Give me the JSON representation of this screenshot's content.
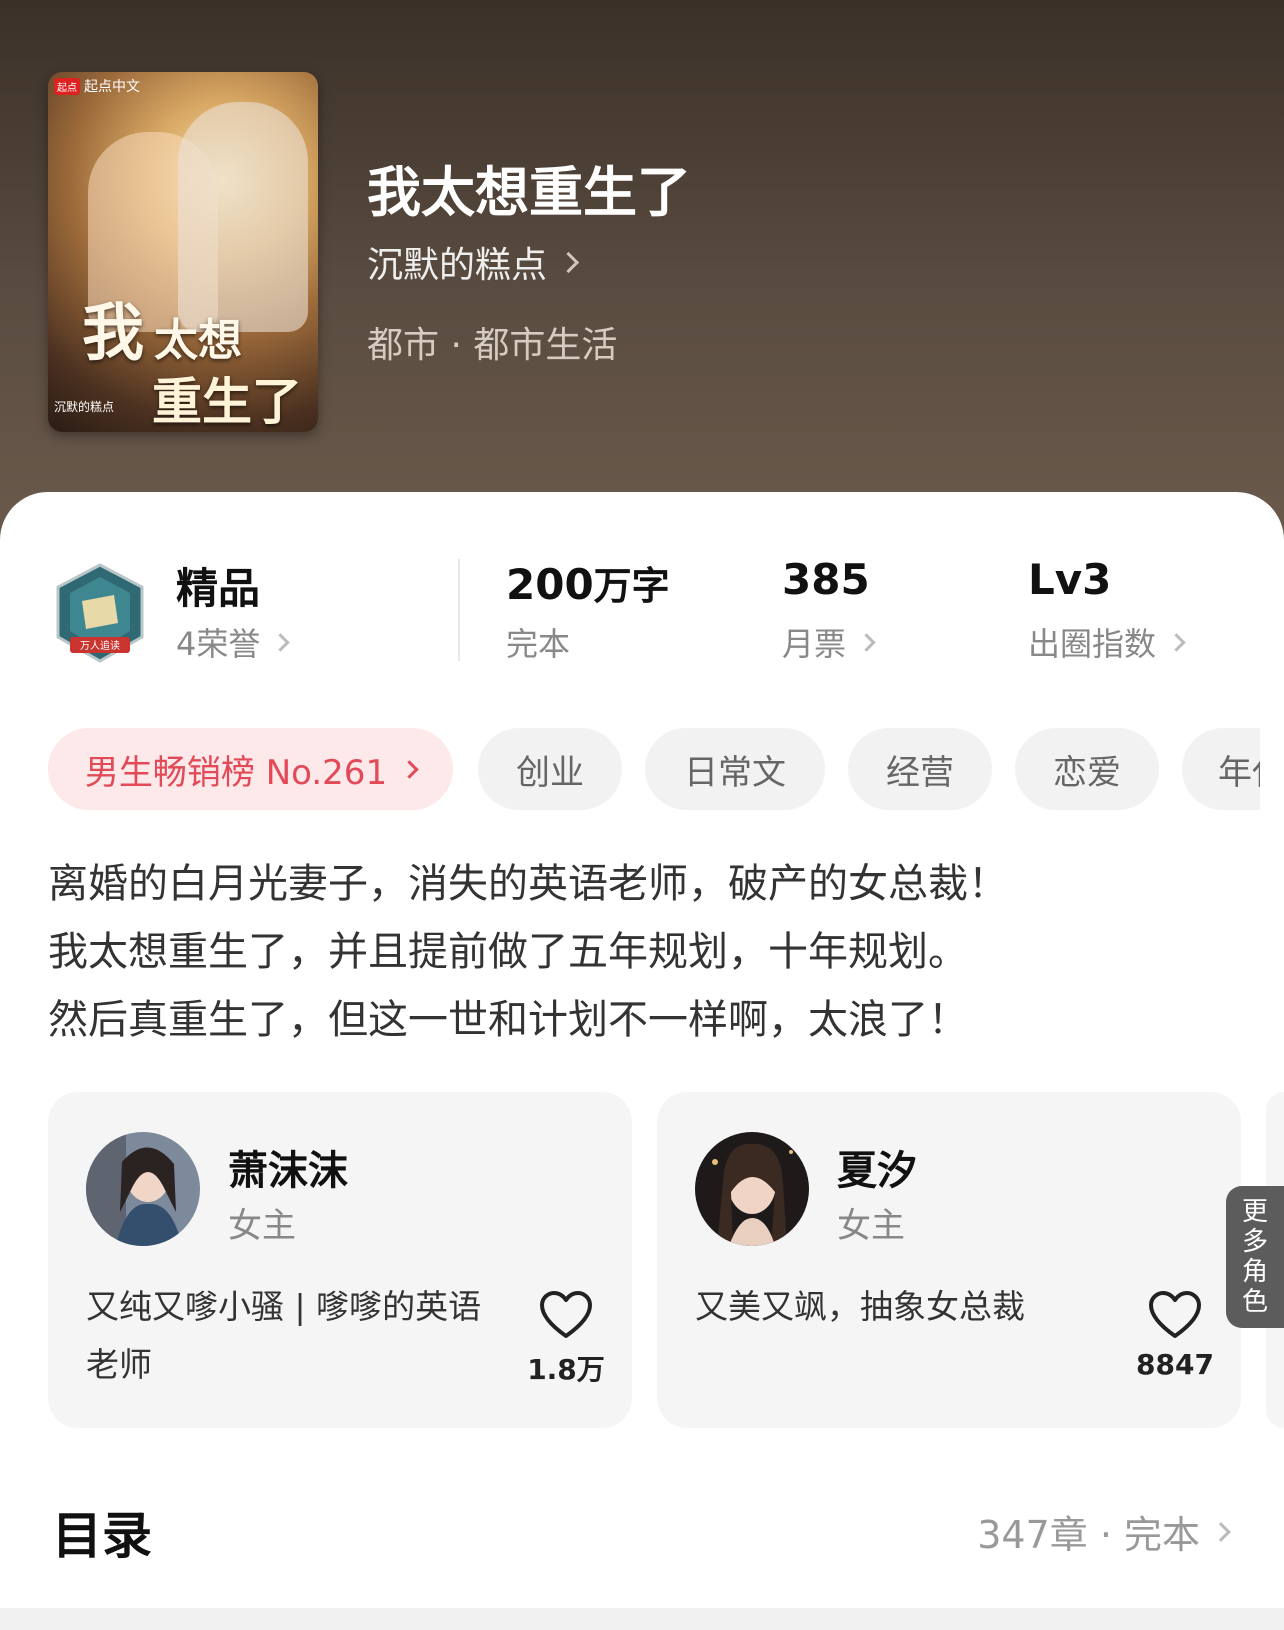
{
  "book": {
    "cover": {
      "publisher": "起点",
      "publisher_sub": "起点中文",
      "title_line1": "我",
      "title_line2": "太想",
      "title_line3": "重生了",
      "author_small": "沉默的糕点"
    },
    "title": "我太想重生了",
    "author": "沉默的糕点",
    "genre": "都市 · 都市生活"
  },
  "stats": {
    "quality": {
      "label": "精品",
      "sub": "4荣誉",
      "medal_text": "万人追读"
    },
    "words": {
      "value": "200",
      "unit": "万字",
      "sub": "完本"
    },
    "tickets": {
      "value": "385",
      "sub": "月票"
    },
    "index": {
      "value": "Lv3",
      "sub": "出圈指数"
    }
  },
  "tags": {
    "rank": "男生畅销榜 No.261",
    "items": [
      "创业",
      "日常文",
      "经营",
      "恋爱",
      "年代"
    ]
  },
  "description": [
    "离婚的白月光妻子，消失的英语老师，破产的女总裁！",
    "我太想重生了，并且提前做了五年规划，十年规划。",
    "然后真重生了，但这一世和计划不一样啊，太浪了！"
  ],
  "characters": [
    {
      "name": "萧沫沫",
      "role": "女主",
      "desc": "又纯又嗲小骚 | 嗲嗲的英语老师",
      "likes": "1.8万"
    },
    {
      "name": "夏汐",
      "role": "女主",
      "desc": "又美又飒，抽象女总裁",
      "likes": "8847"
    }
  ],
  "more_roles": [
    "更",
    "多",
    "角",
    "色"
  ],
  "toc": {
    "title": "目录",
    "info": "347章 · 完本"
  },
  "colors": {
    "hero": "#4a3d33",
    "rank_bg": "#fde8ea",
    "rank_text": "#e34a57",
    "tag_bg": "#f2f2f2"
  }
}
